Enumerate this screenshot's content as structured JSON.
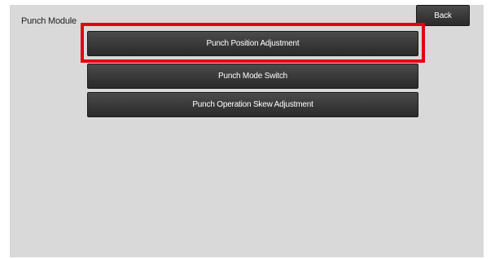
{
  "header": {
    "title": "Punch Module",
    "back_label": "Back"
  },
  "menu": {
    "items": [
      {
        "label": "Punch Position Adjustment",
        "highlighted": true
      },
      {
        "label": "Punch Mode Switch",
        "highlighted": false
      },
      {
        "label": "Punch Operation Skew Adjustment",
        "highlighted": false
      }
    ]
  },
  "colors": {
    "highlight": "#e50012",
    "panel_background": "#d9d9d9",
    "button_background": "#3a3a3a"
  }
}
